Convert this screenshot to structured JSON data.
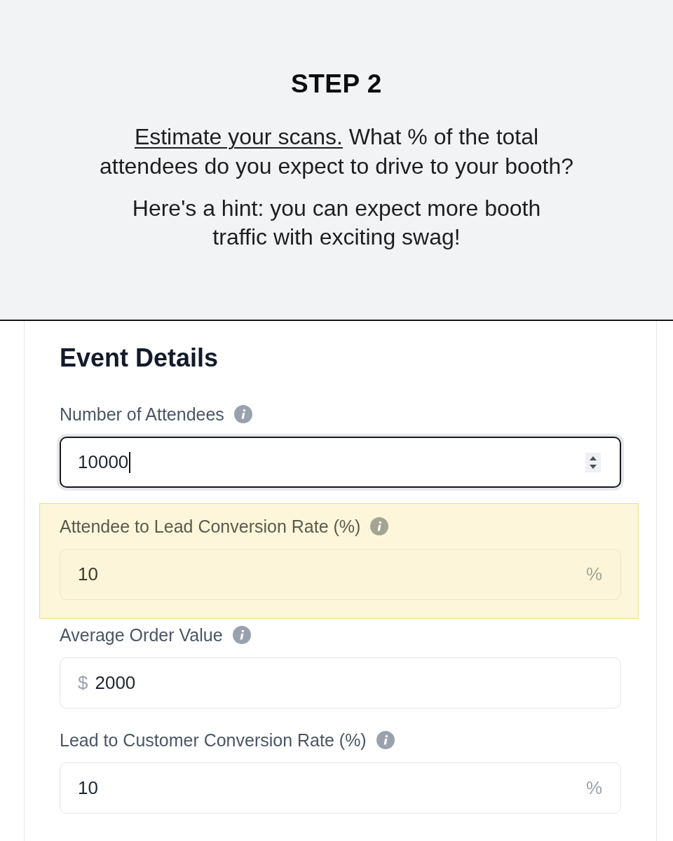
{
  "header": {
    "title": "STEP 2",
    "intro": {
      "link": "Estimate your scans.",
      "text": "What % of the total attendees do you expect to drive to your booth?"
    },
    "hint": "Here's a hint: you can expect more booth traffic with exciting swag!"
  },
  "card": {
    "title": "Event Details",
    "fields": [
      {
        "label": "Number of Attendees",
        "kind": "number",
        "value": "10000",
        "focused": true,
        "highlighted": false
      },
      {
        "label": "Attendee to Lead Conversion Rate (%)",
        "kind": "text",
        "value": "10",
        "suffix": "%",
        "focused": false,
        "highlighted": true
      },
      {
        "label": "Average Order Value",
        "kind": "text",
        "prefix": "$",
        "value": "2000",
        "focused": false,
        "highlighted": false
      },
      {
        "label": "Lead to Customer Conversion Rate (%)",
        "kind": "text",
        "value": "10",
        "suffix": "%",
        "focused": false,
        "highlighted": false
      }
    ]
  }
}
